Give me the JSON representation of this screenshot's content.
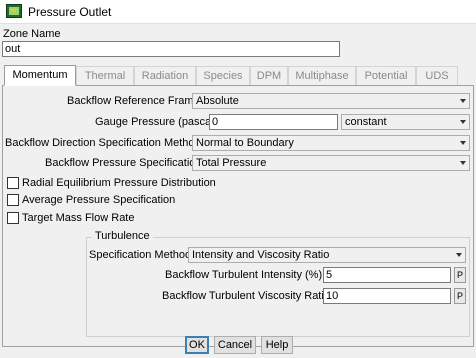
{
  "window": {
    "title": "Pressure Outlet"
  },
  "zone": {
    "label": "Zone Name",
    "value": "out"
  },
  "tabs": [
    {
      "label": "Momentum",
      "active": true
    },
    {
      "label": "Thermal"
    },
    {
      "label": "Radiation"
    },
    {
      "label": "Species"
    },
    {
      "label": "DPM"
    },
    {
      "label": "Multiphase"
    },
    {
      "label": "Potential"
    },
    {
      "label": "UDS"
    }
  ],
  "momentum": {
    "backflow_reference_frame": {
      "label": "Backflow Reference Frame",
      "value": "Absolute"
    },
    "gauge_pressure": {
      "label": "Gauge Pressure (pascal)",
      "value": "0",
      "method": "constant"
    },
    "backflow_direction": {
      "label": "Backflow Direction Specification Method",
      "value": "Normal to Boundary"
    },
    "backflow_pressure_spec": {
      "label": "Backflow Pressure Specification",
      "value": "Total Pressure"
    },
    "checkboxes": [
      {
        "label": "Radial Equilibrium Pressure Distribution",
        "checked": false
      },
      {
        "label": "Average Pressure Specification",
        "checked": false
      },
      {
        "label": "Target Mass Flow Rate",
        "checked": false
      }
    ],
    "turbulence": {
      "title": "Turbulence",
      "spec_method": {
        "label": "Specification Method",
        "value": "Intensity and Viscosity Ratio"
      },
      "intensity": {
        "label": "Backflow Turbulent Intensity (%)",
        "value": "5",
        "p": "P"
      },
      "viscosity_ratio": {
        "label": "Backflow Turbulent Viscosity Ratio",
        "value": "10",
        "p": "P"
      }
    }
  },
  "buttons": {
    "ok": "OK",
    "cancel": "Cancel",
    "help": "Help"
  }
}
